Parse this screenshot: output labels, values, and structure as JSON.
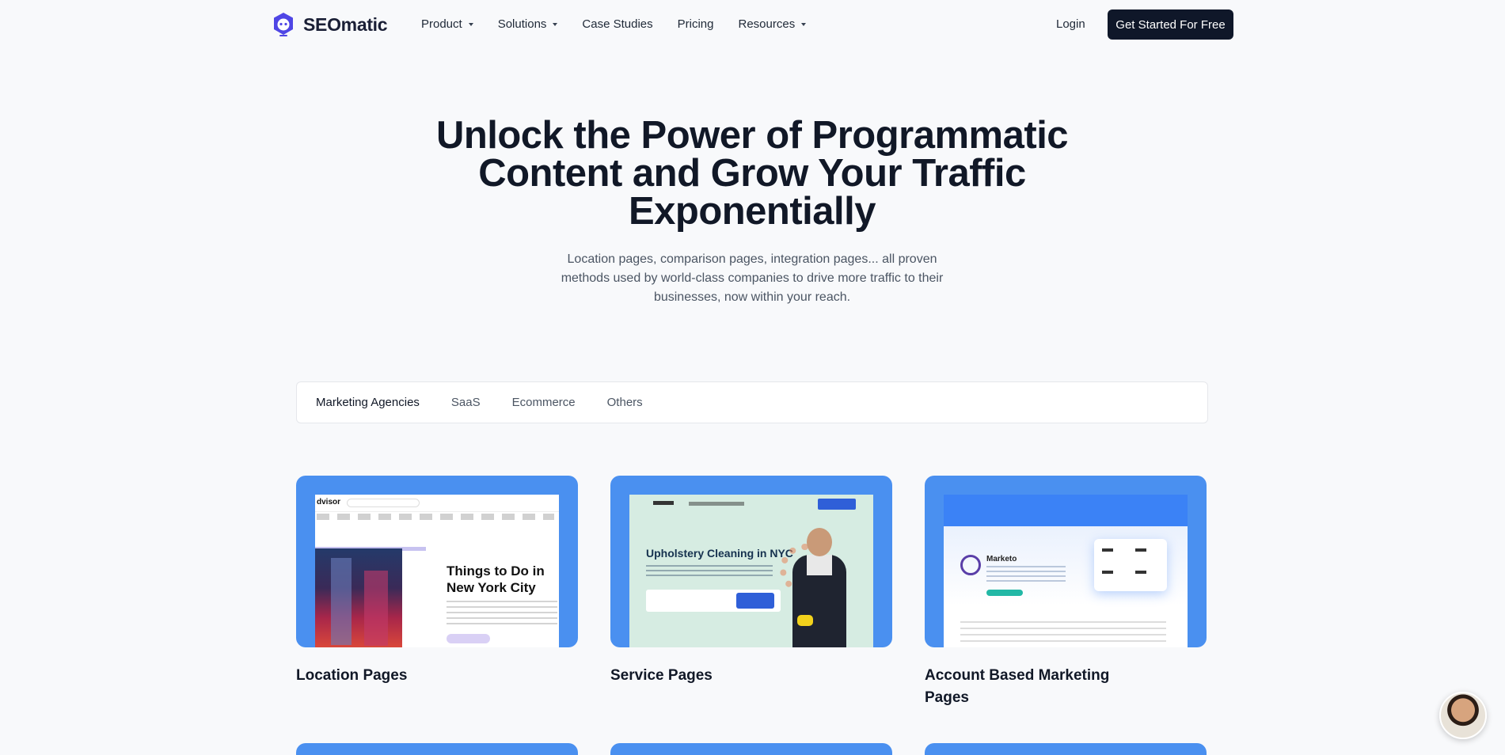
{
  "nav": {
    "brand": "SEOmatic",
    "menu": [
      {
        "label": "Product",
        "dropdown": true
      },
      {
        "label": "Solutions",
        "dropdown": true
      },
      {
        "label": "Case Studies",
        "dropdown": false
      },
      {
        "label": "Pricing",
        "dropdown": false
      },
      {
        "label": "Resources",
        "dropdown": true
      }
    ],
    "login": "Login",
    "cta": "Get Started For Free"
  },
  "hero": {
    "title_lines": [
      "Unlock the Power of Programmatic",
      "Content and Grow Your Traffic",
      "Exponentially"
    ],
    "subtitle": "Location pages, comparison pages, integration pages... all proven methods used by world-class companies to drive more traffic to their businesses, now within your reach."
  },
  "tabs": {
    "items": [
      "Marketing Agencies",
      "SaaS",
      "Ecommerce",
      "Others"
    ],
    "active": "Marketing Agencies"
  },
  "cards": [
    {
      "title": "Location Pages",
      "preview": {
        "logo": "dvisor",
        "heading": "Things to Do in New York City"
      }
    },
    {
      "title": "Service Pages",
      "preview": {
        "heading": "Upholstery Cleaning in NYC"
      }
    },
    {
      "title": "Account Based Marketing Pages",
      "preview": {
        "heading": "Marketo"
      }
    }
  ],
  "colors": {
    "accent": "#4a90f0",
    "cta_bg": "#0f1729",
    "brand": "#4f46e5"
  }
}
